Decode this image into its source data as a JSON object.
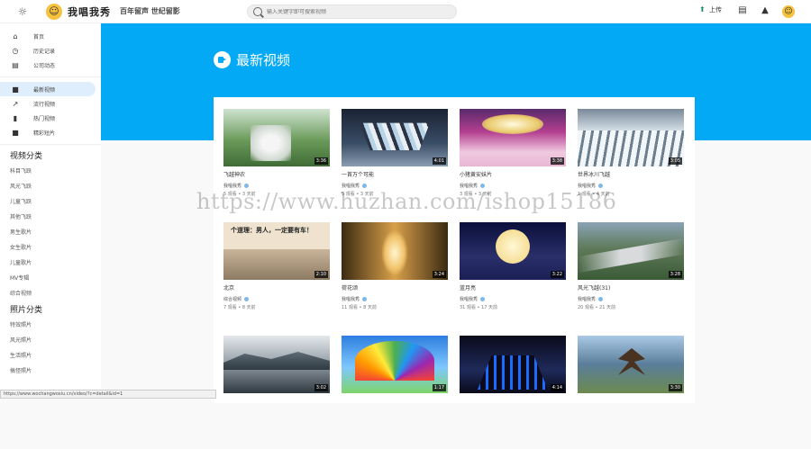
{
  "header": {
    "logo_text": "我唱我秀",
    "slogan": "百年留声 世纪留影",
    "search_placeholder": "输入关键字即可搜索视频",
    "upload_label": "上传"
  },
  "sidebar": {
    "nav": [
      {
        "label": "首页",
        "icon": "home-icon",
        "glyph": "⌂"
      },
      {
        "label": "历史记录",
        "icon": "history-icon",
        "glyph": "◷"
      },
      {
        "label": "公司动态",
        "icon": "news-icon",
        "glyph": "▤"
      }
    ],
    "nav2": [
      {
        "label": "最新视频",
        "icon": "video-icon",
        "glyph": "■",
        "active": true
      },
      {
        "label": "流行视频",
        "icon": "trending-icon",
        "glyph": "↗"
      },
      {
        "label": "热门视频",
        "icon": "chart-icon",
        "glyph": "▮"
      },
      {
        "label": "精彩短片",
        "icon": "film-icon",
        "glyph": "■"
      }
    ],
    "video_section_title": "视频分类",
    "video_categories": [
      "科目飞跃",
      "风光飞跃",
      "儿童飞跃",
      "其他飞跃",
      "男生歌片",
      "女生歌片",
      "儿童歌片",
      "MV专辑",
      "综合视频"
    ],
    "photo_section_title": "照片分类",
    "photo_categories": [
      "特效照片",
      "风光照片",
      "生活照片",
      "搞怪照片"
    ]
  },
  "main": {
    "page_title": "最新视频",
    "videos": [
      {
        "title": "飞越神农",
        "duration": "3:36",
        "channel": "我唱我秀",
        "meta": "5 观看 • 3 天前"
      },
      {
        "title": "一首万个可能",
        "duration": "4:01",
        "channel": "我唱我秀",
        "meta": "5 观看 • 3 天前"
      },
      {
        "title": "小猪黄安妹片",
        "duration": "3:38",
        "channel": "我唱我秀",
        "meta": "3 观看 • 3 天前"
      },
      {
        "title": "世界冰川飞越",
        "duration": "3:05",
        "channel": "我唱我秀",
        "meta": "1 观看 • 4 天前"
      },
      {
        "title": "北京",
        "duration": "2:10",
        "channel": "综合视频",
        "meta": "7 观看 • 8 天前"
      },
      {
        "title": "荷花颂",
        "duration": "3:24",
        "channel": "我唱我秀",
        "meta": "11 观看 • 8 天前"
      },
      {
        "title": "蓝月亮",
        "duration": "3:22",
        "channel": "我唱我秀",
        "meta": "31 观看 • 17 天前"
      },
      {
        "title": "风光飞越(31)",
        "duration": "3:28",
        "channel": "我唱我秀",
        "meta": "20 观看 • 21 天前"
      },
      {
        "title": "",
        "duration": "3:02",
        "channel": "",
        "meta": ""
      },
      {
        "title": "",
        "duration": "1:17",
        "channel": "",
        "meta": ""
      },
      {
        "title": "",
        "duration": "4:14",
        "channel": "",
        "meta": ""
      },
      {
        "title": "",
        "duration": "3:30",
        "channel": "",
        "meta": ""
      }
    ],
    "thumb5_text": "个道理：男人，一定要有车！"
  },
  "watermark": "https://www.huzhan.com/ishop15186",
  "status_url": "https://www.wochangwoxiu.cn/video/?c=detail&id=1",
  "colors": {
    "banner": "#03a9f4",
    "active_nav": "#dfeefd"
  }
}
